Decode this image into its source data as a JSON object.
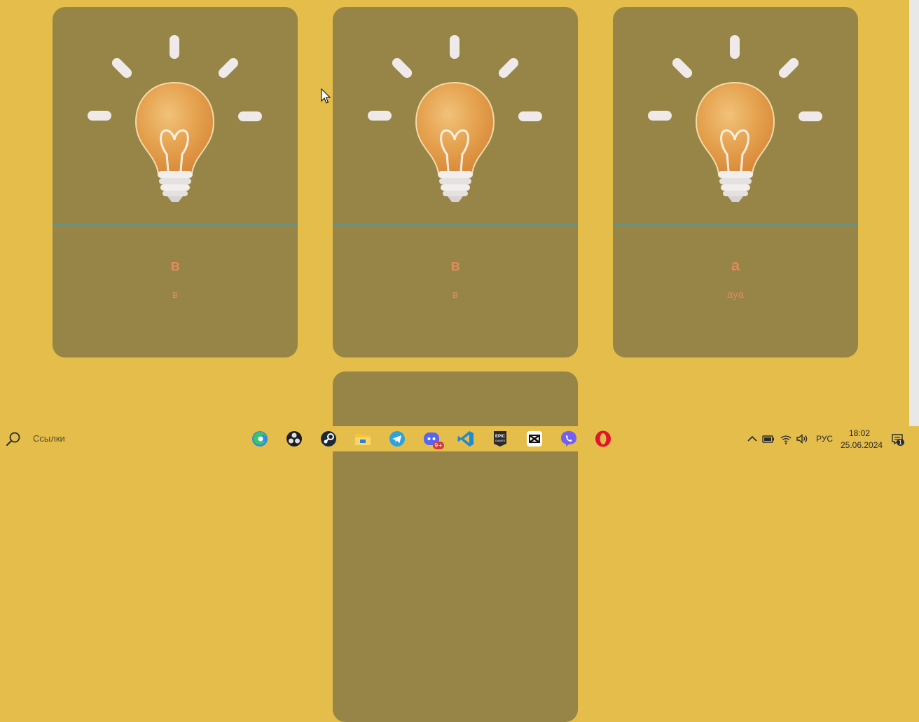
{
  "cards": [
    {
      "title": "в",
      "subtitle": "в",
      "image": "lightbulb-image"
    },
    {
      "title": "в",
      "subtitle": "в",
      "image": "lightbulb-image"
    },
    {
      "title": "а",
      "subtitle": "aya",
      "image": "lightbulb-image"
    },
    {
      "title": "",
      "subtitle": "",
      "image": ""
    }
  ],
  "taskbar": {
    "search_placeholder": "Ссылки",
    "apps": [
      "edge-icon",
      "obs-icon",
      "steam-icon",
      "file-explorer-icon",
      "telegram-icon",
      "discord-icon",
      "vscode-icon",
      "epic-games-icon",
      "capcut-icon",
      "viber-icon",
      "opera-icon"
    ],
    "discord_badge": "9+",
    "language": "РУС",
    "time": "18:02",
    "date": "25.06.2024",
    "notifications_count": "1"
  },
  "colors": {
    "page_bg": "#e4bd4a",
    "card_bg": "#968546",
    "accent_text": "#e08a5a",
    "divider": "#4e9aa4"
  }
}
